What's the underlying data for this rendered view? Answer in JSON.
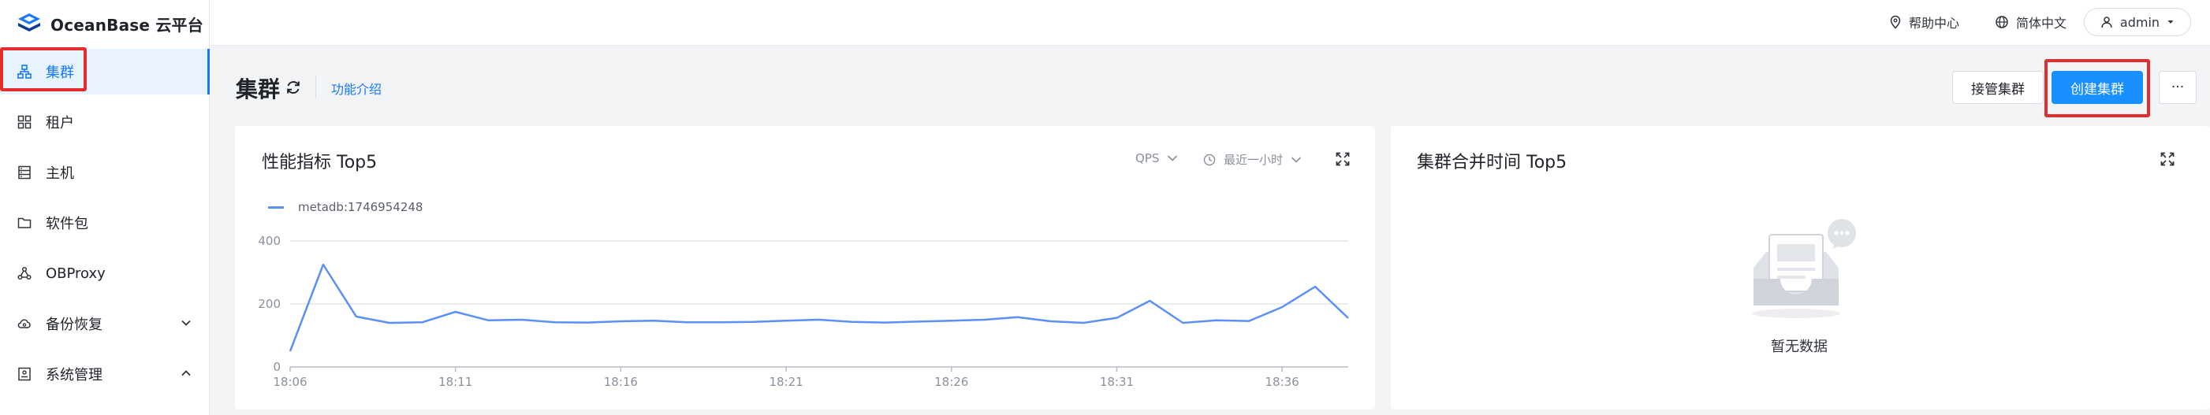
{
  "app": {
    "logo_text": "OceanBase 云平台"
  },
  "sidebar": {
    "items": [
      {
        "label": "集群",
        "icon": "cluster-icon"
      },
      {
        "label": "租户",
        "icon": "tenant-grid-icon"
      },
      {
        "label": "主机",
        "icon": "host-icon"
      },
      {
        "label": "软件包",
        "icon": "folder-icon"
      },
      {
        "label": "OBProxy",
        "icon": "proxy-icon"
      },
      {
        "label": "备份恢复",
        "icon": "cloud-backup-icon"
      },
      {
        "label": "系统管理",
        "icon": "system-icon"
      }
    ]
  },
  "topbar": {
    "help": "帮助中心",
    "language": "简体中文",
    "user": "admin"
  },
  "page": {
    "title": "集群",
    "feature_link": "功能介绍",
    "takeover_button": "接管集群",
    "create_button": "创建集群",
    "more_button": "···"
  },
  "perf_card": {
    "title": "性能指标 Top5",
    "metric_select": "QPS",
    "time_select": "最近一小时"
  },
  "merge_card": {
    "title": "集群合并时间 Top5",
    "empty_text": "暂无数据"
  },
  "chart_data": {
    "type": "line",
    "x": [
      "18:06",
      "18:07",
      "18:08",
      "18:09",
      "18:10",
      "18:11",
      "18:12",
      "18:13",
      "18:14",
      "18:15",
      "18:16",
      "18:17",
      "18:18",
      "18:19",
      "18:20",
      "18:21",
      "18:22",
      "18:23",
      "18:24",
      "18:25",
      "18:26",
      "18:27",
      "18:28",
      "18:29",
      "18:30",
      "18:31",
      "18:32",
      "18:33",
      "18:34",
      "18:35",
      "18:36",
      "18:37",
      "18:38"
    ],
    "xticks": [
      "18:06",
      "18:11",
      "18:16",
      "18:21",
      "18:26",
      "18:31",
      "18:36"
    ],
    "series": [
      {
        "name": "metadb:1746954248",
        "color": "#5b8ff9",
        "values": [
          50,
          325,
          160,
          140,
          142,
          175,
          148,
          150,
          142,
          141,
          145,
          147,
          142,
          142,
          143,
          147,
          150,
          143,
          141,
          144,
          147,
          150,
          158,
          145,
          140,
          156,
          210,
          140,
          148,
          146,
          190,
          255,
          155
        ]
      }
    ],
    "ylim": [
      0,
      400
    ],
    "yticks": [
      0,
      200,
      400
    ],
    "grid": true,
    "legend": "top-left"
  },
  "colors": {
    "accent": "#1677ff",
    "primary_button": "#1890ff",
    "highlight": "#e42d2d"
  }
}
